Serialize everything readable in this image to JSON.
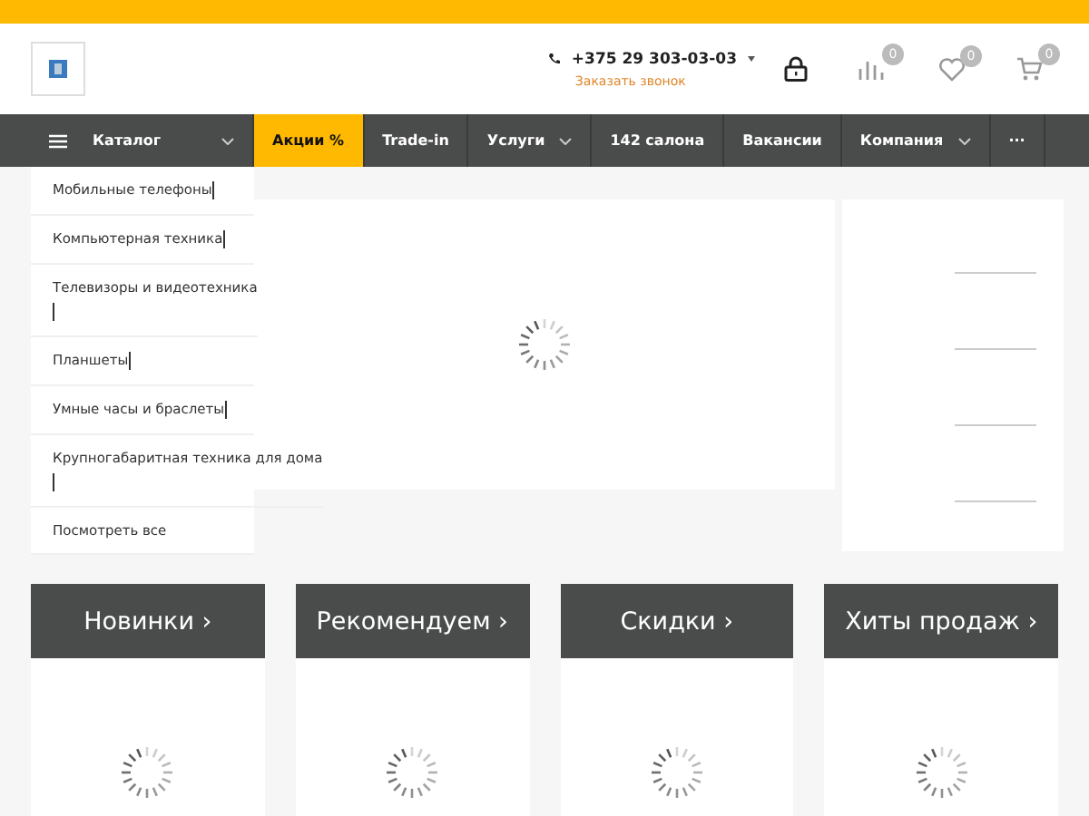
{
  "header": {
    "phone": "+375 29 303-03-03",
    "callback": "Заказать звонок",
    "counters": [
      {
        "kind": "compare",
        "count": "0"
      },
      {
        "kind": "favorites",
        "count": "0"
      },
      {
        "kind": "cart",
        "count": "0"
      }
    ]
  },
  "nav": [
    {
      "label": "Каталог",
      "kind": "catalog",
      "dropdown": true,
      "selected": false
    },
    {
      "label": "Акции %",
      "kind": "link",
      "dropdown": false,
      "selected": true
    },
    {
      "label": "Trade-in",
      "kind": "link",
      "dropdown": false,
      "selected": false
    },
    {
      "label": "Услуги",
      "kind": "link",
      "dropdown": true,
      "selected": false
    },
    {
      "label": "142 салона",
      "kind": "link",
      "dropdown": false,
      "selected": false
    },
    {
      "label": "Вакансии",
      "kind": "link",
      "dropdown": false,
      "selected": false
    },
    {
      "label": "Компания",
      "kind": "link",
      "dropdown": true,
      "selected": false
    },
    {
      "label": "···",
      "kind": "more",
      "dropdown": false,
      "selected": false
    }
  ],
  "catalog_menu": [
    {
      "label": "Мобильные телефоны",
      "text_cursor": true,
      "cursor_on_new_line": false
    },
    {
      "label": "Компьютерная техника",
      "text_cursor": true,
      "cursor_on_new_line": false
    },
    {
      "label": "Телевизоры и видеотехника",
      "text_cursor": true,
      "cursor_on_new_line": true
    },
    {
      "label": "Планшеты",
      "text_cursor": true,
      "cursor_on_new_line": false
    },
    {
      "label": "Умные часы и браслеты",
      "text_cursor": true,
      "cursor_on_new_line": false
    },
    {
      "label": "Крупногабаритная техника для дома",
      "text_cursor": true,
      "cursor_on_new_line": true
    },
    {
      "label": "Посмотреть все",
      "text_cursor": false
    }
  ],
  "tabs": [
    {
      "label": "Новинки ›"
    },
    {
      "label": "Рекомендуем ›"
    },
    {
      "label": "Скидки ›"
    },
    {
      "label": "Хиты продаж ›"
    }
  ]
}
